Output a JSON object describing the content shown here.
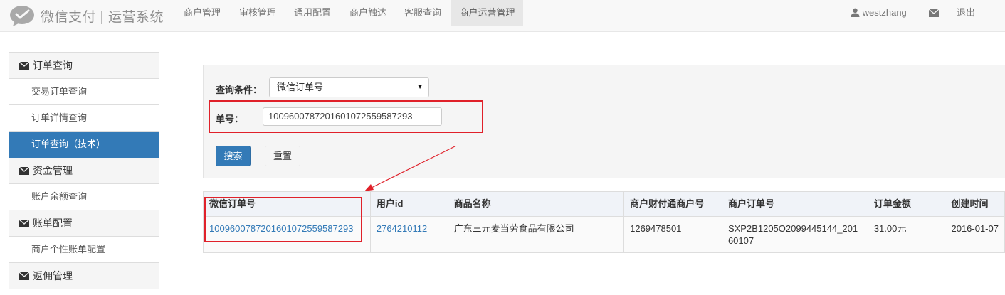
{
  "brand": {
    "name": "微信支付",
    "divider": "|",
    "subtitle": "运营系统"
  },
  "nav": {
    "tabs": [
      "商户管理",
      "审核管理",
      "通用配置",
      "商户触达",
      "客服查询",
      "商户运营管理"
    ],
    "active_tab": "商户运营管理",
    "user": "westzhang",
    "logout": "退出"
  },
  "sidebar": {
    "groups": [
      {
        "label": "订单查询",
        "items": [
          "交易订单查询",
          "订单详情查询",
          "订单查询（技术）"
        ]
      },
      {
        "label": "资金管理",
        "items": [
          "账户余额查询"
        ]
      },
      {
        "label": "账单配置",
        "items": [
          "商户个性账单配置"
        ]
      },
      {
        "label": "返佣管理",
        "items": []
      }
    ],
    "active_item": "订单查询（技术）"
  },
  "query": {
    "condition_label": "查询条件：",
    "condition_value": "微信订单号",
    "order_no_label": "单号：",
    "order_no_value": "1009600787201601072559587293",
    "search_button": "搜索",
    "reset_button": "重置"
  },
  "table": {
    "headers": [
      "微信订单号",
      "用户id",
      "商品名称",
      "商户财付通商户号",
      "商户订单号",
      "订单金额",
      "创建时间"
    ],
    "rows": [
      [
        "1009600787201601072559587293",
        "2764210112",
        "广东三元麦当劳食品有限公司",
        "1269478501",
        "SXP2B1205O2099445144_20160107",
        "31.00元",
        "2016-01-07"
      ]
    ]
  },
  "colors": {
    "accent": "#337ab7",
    "highlight": "#e0212a",
    "navbar": "#f8f8f8"
  }
}
